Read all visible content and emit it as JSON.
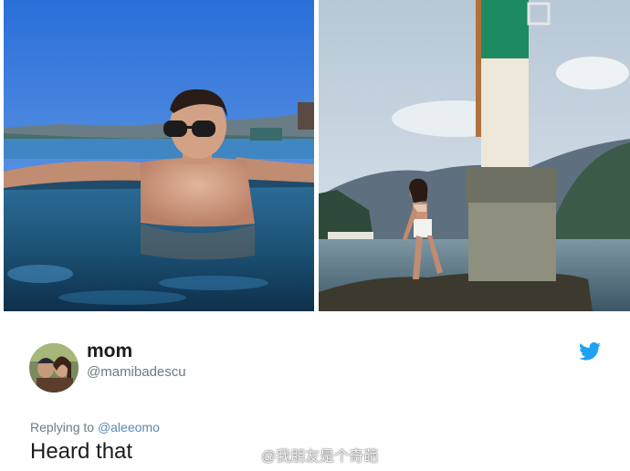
{
  "tweet": {
    "display_name": "mom",
    "handle": "@mamibadescu",
    "reply_prefix": "Replying to",
    "reply_to": "@aleeomo",
    "text": "Heard that"
  },
  "photos": [
    {
      "subject": "man in infinity pool"
    },
    {
      "subject": "woman beside lighthouse post"
    }
  ],
  "watermark": {
    "text": "@我朋友是个奇葩"
  },
  "icons": {
    "platform": "twitter-bird-icon",
    "watermark": "weibo-icon"
  },
  "colors": {
    "twitter_blue": "#1da1f2",
    "text": "#1c1c1c",
    "muted": "#6b7a86"
  }
}
